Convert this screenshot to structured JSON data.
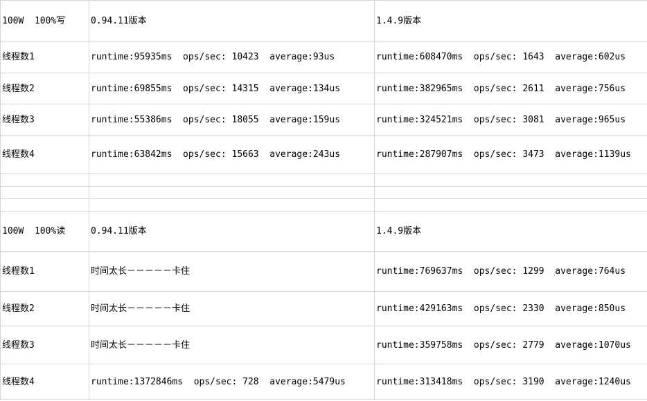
{
  "write_section": {
    "header": [
      "100W  100%写",
      "0.94.11版本",
      "1.4.9版本"
    ],
    "rows": [
      [
        "线程数1",
        "runtime:95935ms  ops/sec: 10423  average:93us",
        "runtime:608470ms  ops/sec: 1643  average:602us"
      ],
      [
        "线程数2",
        "runtime:69855ms  ops/sec: 14315  average:134us",
        "runtime:382965ms  ops/sec: 2611  average:756us"
      ],
      [
        "线程数3",
        "runtime:55386ms  ops/sec: 18055  average:159us",
        "runtime:324521ms  ops/sec: 3081  average:965us"
      ],
      [
        "线程数4",
        "runtime:63842ms  ops/sec: 15663  average:243us",
        "runtime:287907ms  ops/sec: 3473  average:1139us"
      ]
    ]
  },
  "read_section": {
    "header": [
      "100W  100%读",
      "0.94.11版本",
      "1.4.9版本"
    ],
    "rows": [
      [
        "线程数1",
        "时间太长－－－－－卡住",
        "runtime:769637ms  ops/sec: 1299  average:764us"
      ],
      [
        "线程数2",
        "时间太长－－－－－卡住",
        "runtime:429163ms  ops/sec: 2330  average:850us"
      ],
      [
        "线程数3",
        "时间太长－－－－－卡住",
        "runtime:359758ms  ops/sec: 2779  average:1070us"
      ],
      [
        "线程数4",
        "runtime:1372846ms  ops/sec: 728  average:5479us",
        "runtime:313418ms  ops/sec: 3190  average:1240us"
      ]
    ]
  }
}
